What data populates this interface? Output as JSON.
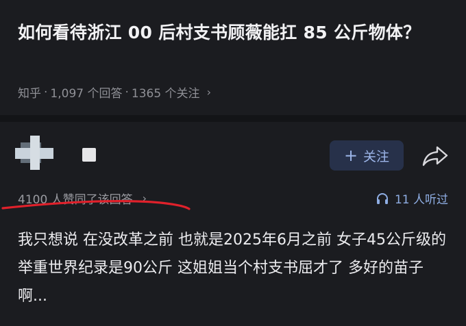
{
  "question": {
    "title": "如何看待浙江 00 后村支书顾薇能扛 85 公斤物体？",
    "source": "知乎",
    "answers": "1,097 个回答",
    "followers": "1365 个关注",
    "separator": "·",
    "chevron": "›"
  },
  "answer": {
    "follow_label": "关注",
    "follow_plus": "+",
    "votes_text": "4100 人赞同了该回答",
    "votes_chevron": "›",
    "listened_text": "11 人听过",
    "body": "我只想说 在没改革之前 也就是2025年6月之前 女子45公斤级的举重世界纪录是90公斤 这姐姐当个村支书屈才了 多好的苗子啊..."
  },
  "colors": {
    "background": "#1b1c20",
    "accent_blue": "#8faee4",
    "annotation_red": "#e0212b"
  },
  "icons": [
    "share-icon",
    "headphones-icon",
    "plus-icon",
    "chevron-right-icon"
  ]
}
